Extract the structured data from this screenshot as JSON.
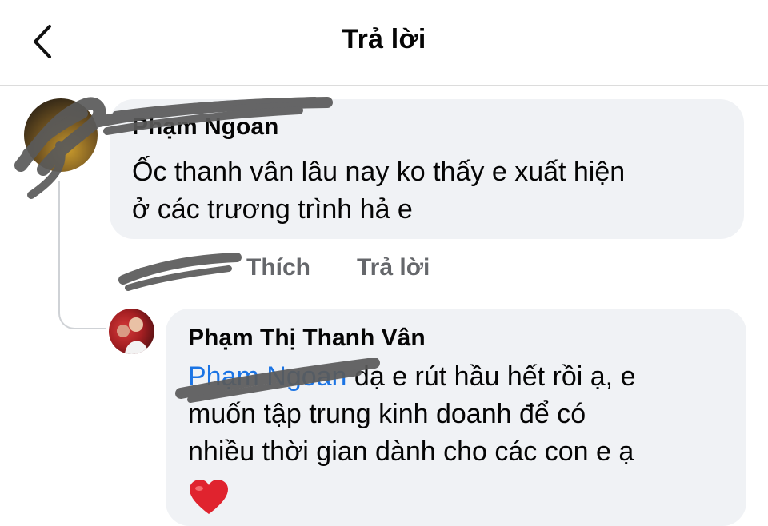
{
  "header": {
    "title": "Trả lời",
    "back_icon": "chevron-left-icon"
  },
  "comments": [
    {
      "author": "Phạm Ngoan",
      "text_line1": "Ốc thanh vân lâu nay ko thấy e xuất hiện",
      "text_line2": "ở các trương trình  hả e",
      "time": "",
      "like_label": "Thích",
      "reply_label": "Trả lời"
    }
  ],
  "reply": {
    "author": "Phạm Thị Thanh Vân",
    "mention": "Phạm Ngoan",
    "text_line1": " dạ e rút hầu hết rồi ạ, e",
    "text_line2": "muốn tập trung kinh doanh để có",
    "text_line3": "nhiều thời gian dành cho các con e ạ",
    "emoji": "❤️"
  },
  "colors": {
    "bubble_bg": "#f0f2f5",
    "mention": "#1b74e4",
    "secondary_text": "#65676b",
    "heart": "#e0232e"
  }
}
